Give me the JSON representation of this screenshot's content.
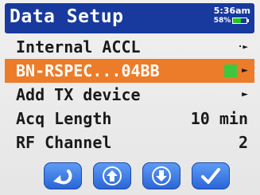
{
  "header": {
    "title": "Data Setup",
    "time": "5:36am",
    "battery_percent": "58%",
    "battery_level": 0.58
  },
  "menu": {
    "items": [
      {
        "label": "Internal ACCL",
        "value": ""
      },
      {
        "label": "BN-RSPEC...04BB",
        "value": ""
      },
      {
        "label": "Add TX device",
        "value": ""
      },
      {
        "label": "Acq Length",
        "value": "10 min"
      },
      {
        "label": "RF Channel",
        "value": "2"
      }
    ]
  },
  "softkeys": [
    "back-icon",
    "up-arrow-icon",
    "down-arrow-icon",
    "checkmark-icon"
  ],
  "colors": {
    "header": "#183a9e",
    "selected_row": "#ec7c2a",
    "status_green": "#3fc63f",
    "button_blue": "#3a78e2"
  }
}
